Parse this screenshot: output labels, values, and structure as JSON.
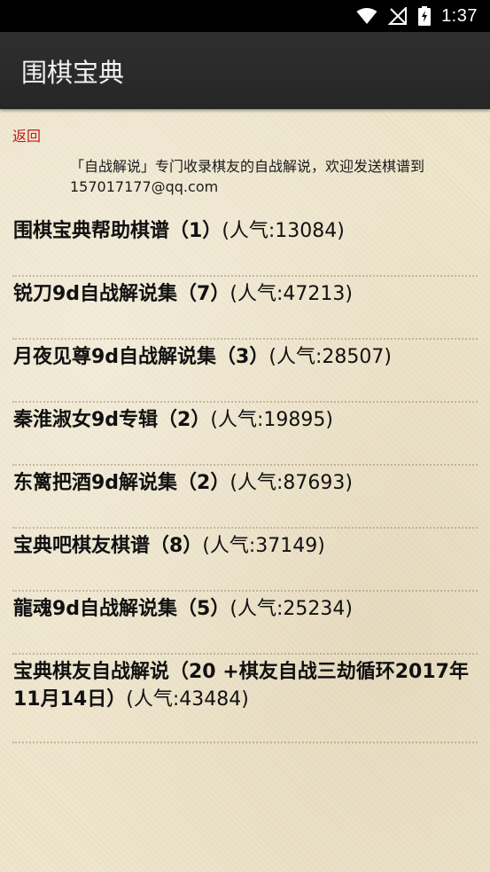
{
  "status_bar": {
    "time": "1:37",
    "icons": [
      "wifi-icon",
      "no-signal-icon",
      "battery-charging-icon"
    ]
  },
  "app_bar": {
    "title": "围棋宝典"
  },
  "back": {
    "label": "返回"
  },
  "notice": {
    "line1": "「自战解说」专门收录棋友的自战解说，欢迎发送棋谱到",
    "line2": "157017177@qq.com"
  },
  "items": [
    {
      "title": "围棋宝典帮助棋谱（1）",
      "popularity": "(人气:13084)"
    },
    {
      "title": "锐刀9d自战解说集（7）",
      "popularity": "(人气:47213)"
    },
    {
      "title": "月夜见尊9d自战解说集（3）",
      "popularity": "(人气:28507)"
    },
    {
      "title": "秦淮淑女9d专辑（2）",
      "popularity": "(人气:19895)"
    },
    {
      "title": "东篱把酒9d解说集（2）",
      "popularity": "(人气:87693)"
    },
    {
      "title": "宝典吧棋友棋谱（8）",
      "popularity": "(人气:37149)"
    },
    {
      "title": "龍魂9d自战解说集（5）",
      "popularity": "(人气:25234)"
    },
    {
      "title": "宝典棋友自战解说（20 +棋友自战三劫循环2017年11月14日）",
      "popularity": "(人气:43484)"
    }
  ]
}
